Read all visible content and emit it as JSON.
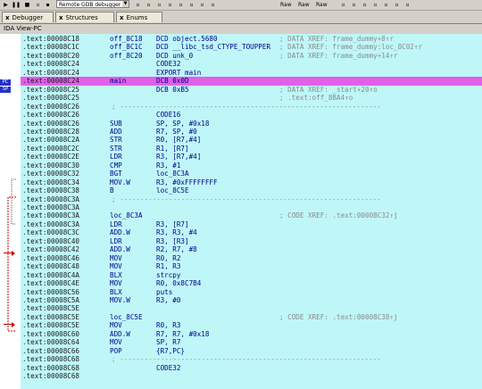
{
  "toolbar": {
    "start_icon": "play-icon",
    "pause_icon": "pause-icon",
    "stop_icon": "stop-icon",
    "debugger_name": "Remote GDB debugger",
    "right_buttons": [
      "Raw",
      "Raw",
      "Raw"
    ]
  },
  "tabs": [
    {
      "label": "Debugger",
      "close": "x"
    },
    {
      "label": "Structures",
      "close": "x"
    },
    {
      "label": "Enums",
      "close": "x"
    }
  ],
  "window": {
    "title": "IDA View-PC"
  },
  "gutter": {
    "pc_tag_1": "PC",
    "pc_tag_2": "SP"
  },
  "listing": [
    {
      "addr": ".text:00008C18",
      "c1": "off_8C18",
      "c2": "DCD object.5680",
      "cm": "; DATA XREF: frame_dummy+8↑r"
    },
    {
      "addr": ".text:00008C1C",
      "c1": "off_8C1C",
      "c2": "DCD __libc_tsd_CTYPE_TOUPPER",
      "cm": "; DATA XREF: frame_dummy:loc_8C02↑r"
    },
    {
      "addr": ".text:00008C20",
      "c1": "off_8C20",
      "c2": "DCD unk_0",
      "cm": "; DATA XREF: frame_dummy+14↑r"
    },
    {
      "addr": ".text:00008C24",
      "c1": "",
      "c2": "CODE32",
      "cm": ""
    },
    {
      "addr": ".text:00008C24",
      "c1": "",
      "c2": "EXPORT main",
      "cm": ""
    },
    {
      "addr": ".text:00008C24",
      "c1": "main",
      "c2": "DCB 0x0D",
      "cm": "",
      "hl": true
    },
    {
      "addr": ".text:00008C25",
      "c1": "",
      "c2": "DCB 0xB5",
      "cm": "; DATA XREF: _start+20↑o"
    },
    {
      "addr": ".text:00008C25",
      "c1": "",
      "c2": "",
      "cm": "; .text:off_8BA4↑o"
    },
    {
      "addr": ".text:00008C26",
      "c1": "",
      "c2": "",
      "cm": "",
      "sep": true
    },
    {
      "addr": ".text:00008C26",
      "c1": "",
      "c2": "CODE16",
      "cm": ""
    },
    {
      "addr": ".text:00008C26",
      "c1": "SUB",
      "c2": "SP, SP, #0x18",
      "cm": ""
    },
    {
      "addr": ".text:00008C28",
      "c1": "ADD",
      "c2": "R7, SP, #0",
      "cm": ""
    },
    {
      "addr": ".text:00008C2A",
      "c1": "STR",
      "c2": "R0, [R7,#4]",
      "cm": ""
    },
    {
      "addr": ".text:00008C2C",
      "c1": "STR",
      "c2": "R1, [R7]",
      "cm": ""
    },
    {
      "addr": ".text:00008C2E",
      "c1": "LDR",
      "c2": "R3, [R7,#4]",
      "cm": ""
    },
    {
      "addr": ".text:00008C30",
      "c1": "CMP",
      "c2": "R3, #1",
      "cm": ""
    },
    {
      "addr": ".text:00008C32",
      "c1": "BGT",
      "c2": "loc_8C3A",
      "cm": ""
    },
    {
      "addr": ".text:00008C34",
      "c1": "MOV.W",
      "c2": "R3, #0xFFFFFFFF",
      "cm": ""
    },
    {
      "addr": ".text:00008C38",
      "c1": "B",
      "c2": "loc_8C5E",
      "cm": ""
    },
    {
      "addr": ".text:00008C3A",
      "c1": "",
      "c2": "",
      "cm": "",
      "sep": true
    },
    {
      "addr": ".text:00008C3A",
      "c1": "",
      "c2": "",
      "cm": ""
    },
    {
      "addr": ".text:00008C3A",
      "c1": "loc_8C3A",
      "c2": "",
      "cm": "; CODE XREF: .text:00008C32↑j"
    },
    {
      "addr": ".text:00008C3A",
      "c1": "LDR",
      "c2": "R3, [R7]",
      "cm": ""
    },
    {
      "addr": ".text:00008C3C",
      "c1": "ADD.W",
      "c2": "R3, R3, #4",
      "cm": ""
    },
    {
      "addr": ".text:00008C40",
      "c1": "LDR",
      "c2": "R3, [R3]",
      "cm": ""
    },
    {
      "addr": ".text:00008C42",
      "c1": "ADD.W",
      "c2": "R2, R7, #8",
      "cm": ""
    },
    {
      "addr": ".text:00008C46",
      "c1": "MOV",
      "c2": "R0, R2",
      "cm": ""
    },
    {
      "addr": ".text:00008C48",
      "c1": "MOV",
      "c2": "R1, R3",
      "cm": ""
    },
    {
      "addr": ".text:00008C4A",
      "c1": "BLX",
      "c2": "strcpy",
      "cm": ""
    },
    {
      "addr": ".text:00008C4E",
      "c1": "MOV",
      "c2": "R0, 0x8C7B4",
      "cm": ""
    },
    {
      "addr": ".text:00008C56",
      "c1": "BLX",
      "c2": "puts",
      "cm": ""
    },
    {
      "addr": ".text:00008C5A",
      "c1": "MOV.W",
      "c2": "R3, #0",
      "cm": ""
    },
    {
      "addr": ".text:00008C5E",
      "c1": "",
      "c2": "",
      "cm": ""
    },
    {
      "addr": ".text:00008C5E",
      "c1": "loc_8C5E",
      "c2": "",
      "cm": "; CODE XREF: .text:00008C38↑j"
    },
    {
      "addr": ".text:00008C5E",
      "c1": "MOV",
      "c2": "R0, R3",
      "cm": ""
    },
    {
      "addr": ".text:00008C60",
      "c1": "ADD.W",
      "c2": "R7, R7, #0x18",
      "cm": ""
    },
    {
      "addr": ".text:00008C64",
      "c1": "MOV",
      "c2": "SP, R7",
      "cm": ""
    },
    {
      "addr": ".text:00008C66",
      "c1": "POP",
      "c2": "{R7,PC}",
      "cm": ""
    },
    {
      "addr": ".text:00008C68",
      "c1": "",
      "c2": "",
      "cm": "",
      "sep": true
    },
    {
      "addr": ".text:00008C68",
      "c1": "",
      "c2": "CODE32",
      "cm": ""
    },
    {
      "addr": ".text:00008C68",
      "c1": "",
      "c2": "",
      "cm": ""
    }
  ],
  "colors": {
    "listing_bg": "#bff7f9",
    "highlight": "#e060e8",
    "code": "#00008b",
    "comment": "#8a8a8a"
  }
}
